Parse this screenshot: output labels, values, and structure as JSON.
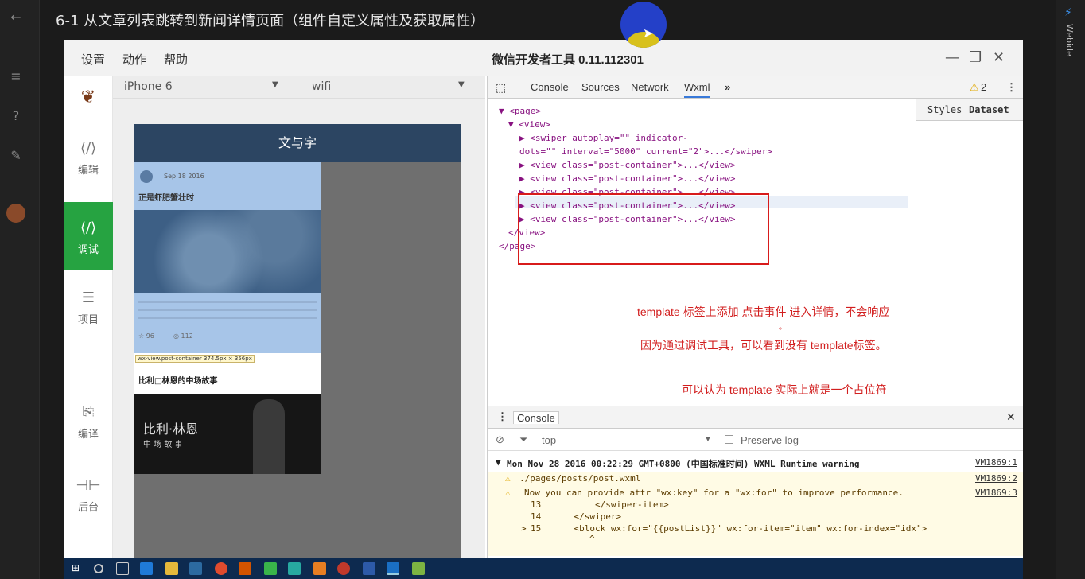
{
  "course": {
    "title": "6-1 从文章列表跳转到新闻详情页面（组件自定义属性及获取属性）",
    "side_label": "Webide"
  },
  "window": {
    "menus": [
      "设置",
      "动作",
      "帮助"
    ],
    "title": "微信开发者工具 0.11.112301"
  },
  "sidebar": {
    "items": [
      {
        "icon": "code-icon",
        "label": "编辑"
      },
      {
        "icon": "debug-icon",
        "label": "调试"
      },
      {
        "icon": "menu-icon",
        "label": "项目"
      },
      {
        "icon": "compile-icon",
        "label": "编译"
      },
      {
        "icon": "backend-icon",
        "label": "后台"
      }
    ]
  },
  "simulator": {
    "device": "iPhone 6",
    "network": "wifi",
    "nav_title": "文与字",
    "post1": {
      "date": "Sep 18 2016",
      "title": "正是虾肥蟹壮时",
      "views": "96",
      "likes": "112"
    },
    "overlay_label": "wx-view.post-container 374.5px × 356px",
    "post2": {
      "date": "Nov 25 2016",
      "title": "比利□林恩的中场故事",
      "poster_title": "比利·林恩",
      "poster_sub": "中 场 故 事"
    }
  },
  "devtools": {
    "tabs": [
      "Console",
      "Sources",
      "Network",
      "Wxml"
    ],
    "active_tab": "Wxml",
    "warning_count": "2",
    "styles_tabs": [
      "Styles",
      "Dataset"
    ],
    "tree": {
      "page_open": "<page>",
      "view_open": "<view>",
      "swiper_line1": "<swiper  autoplay=\"\"  indicator-",
      "swiper_line2": "dots=\"\"  interval=\"5000\"  current=\"2\">...</swiper>",
      "post_rows": [
        "<view  class=\"post-container\">...</view>",
        "<view  class=\"post-container\">...</view>",
        "<view  class=\"post-container\">...</view>",
        "<view  class=\"post-container\">...</view>",
        "<view  class=\"post-container\">...</view>"
      ],
      "view_close": "</view>",
      "page_close": "</page>"
    },
    "notes": [
      "template 标签上添加 点击事件 进入详情，不会响应",
      "。",
      "因为通过调试工具，可以看到没有 template标签。",
      "可以认为 template 实际上就是一个占位符"
    ],
    "console": {
      "title": "Console",
      "filter_context": "top",
      "preserve_log": "Preserve log",
      "header_msg": "Mon Nov 28 2016 00:22:29 GMT+0800 (中国标准时间) WXML Runtime warning",
      "header_src": "VM1869:1",
      "file_msg": "./pages/posts/post.wxml",
      "file_src": "VM1869:2",
      "warn_msg": "Now you can provide attr \"wx:key\" for a \"wx:for\" to improve performance.",
      "warn_src": "VM1869:3",
      "code_lines": [
        {
          "num": "13",
          "code": "        </swiper-item>"
        },
        {
          "num": "14",
          "code": "    </swiper>"
        },
        {
          "num": "15",
          "code": "    <block wx:for=\"{{postList}}\" wx:for-item=\"item\" wx:for-index=\"idx\">"
        }
      ],
      "caret": "^",
      "prompt": ">"
    }
  },
  "colors": {
    "accent_green": "#26a341",
    "red_annotation": "#d21f1f",
    "nav_blue": "#2c4562"
  }
}
